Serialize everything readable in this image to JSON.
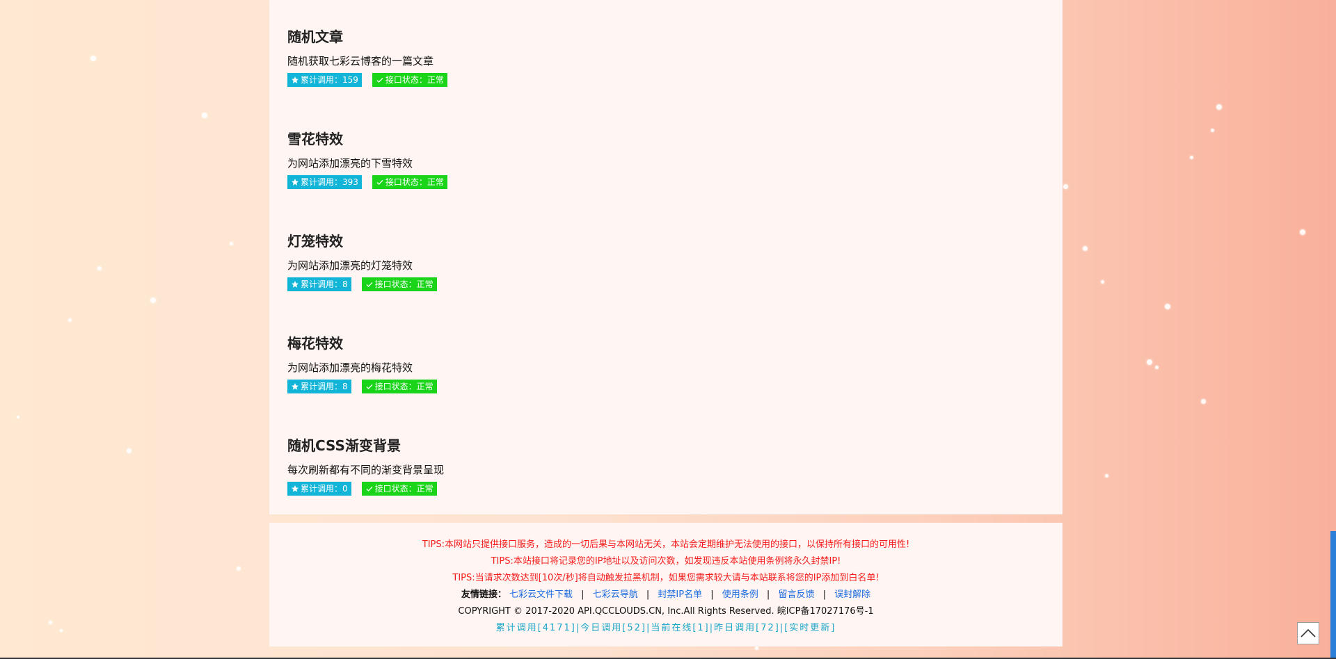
{
  "apis": [
    {
      "title": "随机文章",
      "desc": "随机获取七彩云博客的一篇文章",
      "calls_label": "累计调用：159",
      "status_label": "接口状态：正常"
    },
    {
      "title": "雪花特效",
      "desc": "为网站添加漂亮的下雪特效",
      "calls_label": "累计调用：393",
      "status_label": "接口状态：正常"
    },
    {
      "title": "灯笼特效",
      "desc": "为网站添加漂亮的灯笼特效",
      "calls_label": "累计调用：8",
      "status_label": "接口状态：正常"
    },
    {
      "title": "梅花特效",
      "desc": "为网站添加漂亮的梅花特效",
      "calls_label": "累计调用：8",
      "status_label": "接口状态：正常"
    },
    {
      "title": "随机CSS渐变背景",
      "desc": "每次刷新都有不同的渐变背景呈现",
      "calls_label": "累计调用：0",
      "status_label": "接口状态：正常"
    }
  ],
  "footer": {
    "tips": [
      "TIPS:本网站只提供接口服务，造成的一切后果与本网站无关，本站会定期维护无法使用的接口，以保持所有接口的可用性!",
      "TIPS:本站接口将记录您的IP地址以及访问次数，如发现违反本站使用条例将永久封禁IP!",
      "TIPS:当请求次数达到[10次/秒]将自动触发拉黑机制，如果您需求较大请与本站联系将您的IP添加到白名单!"
    ],
    "links_label": "友情链接：",
    "links": [
      "七彩云文件下载",
      "七彩云导航",
      "封禁IP名单",
      "使用条例",
      "留言反馈",
      "误封解除"
    ],
    "link_separator": "|",
    "copyright": "COPYRIGHT © 2017-2020 API.QCCLOUDS.CN, Inc.All Rights Reserved. 皖ICP备17027176号-1",
    "stats": "累计调用[4171]|今日调用[52]|当前在线[1]|昨日调用[72]|[实时更新]"
  },
  "icons": {
    "calls": "star-icon",
    "status": "check-icon",
    "back_to_top": "chevron-up-icon"
  },
  "colors": {
    "calls_badge": "#12b4d8",
    "status_badge": "#19d419",
    "tips": "#f51d1d",
    "links": "#1a6be0",
    "stats": "#19a5c9"
  }
}
